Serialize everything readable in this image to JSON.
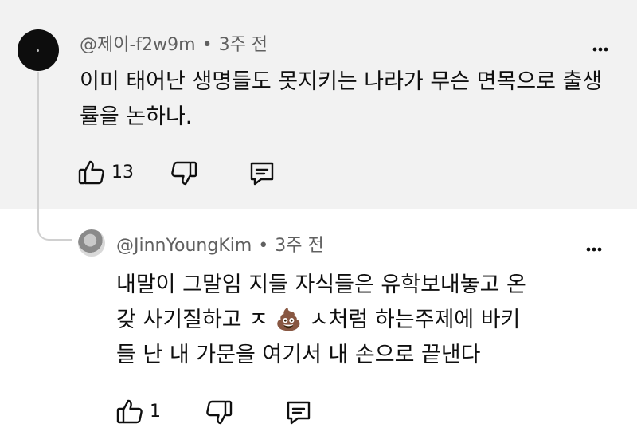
{
  "comments": [
    {
      "author": "@제이-f2w9m",
      "separator": "•",
      "time": "3주 전",
      "text": "이미 태어난 생명들도 못지키는 나라가 무슨 면목으로 출생률을 논하나.",
      "likes": "13",
      "avatar_icon": "dark-avatar"
    },
    {
      "author": "@JinnYoungKim",
      "separator": "•",
      "time": "3주 전",
      "lines": [
        "내말이 그말임 지들 자식들은 유학보내놓고 온",
        "갖 사기질하고 ㅈ 💩 ㅅ처럼 하는주제에 바키",
        "들 난 내 가문을 여기서 내 손으로 끝낸다"
      ],
      "likes": "1",
      "avatar_icon": "photo-avatar"
    }
  ],
  "icons": {
    "like": "thumbs-up-icon",
    "dislike": "thumbs-down-icon",
    "reply": "reply-comment-icon",
    "more": "more-vertical-icon"
  },
  "colors": {
    "highlight_bg": "#f2f2f2",
    "meta_text": "#606060",
    "body_text": "#0f0f0f"
  }
}
